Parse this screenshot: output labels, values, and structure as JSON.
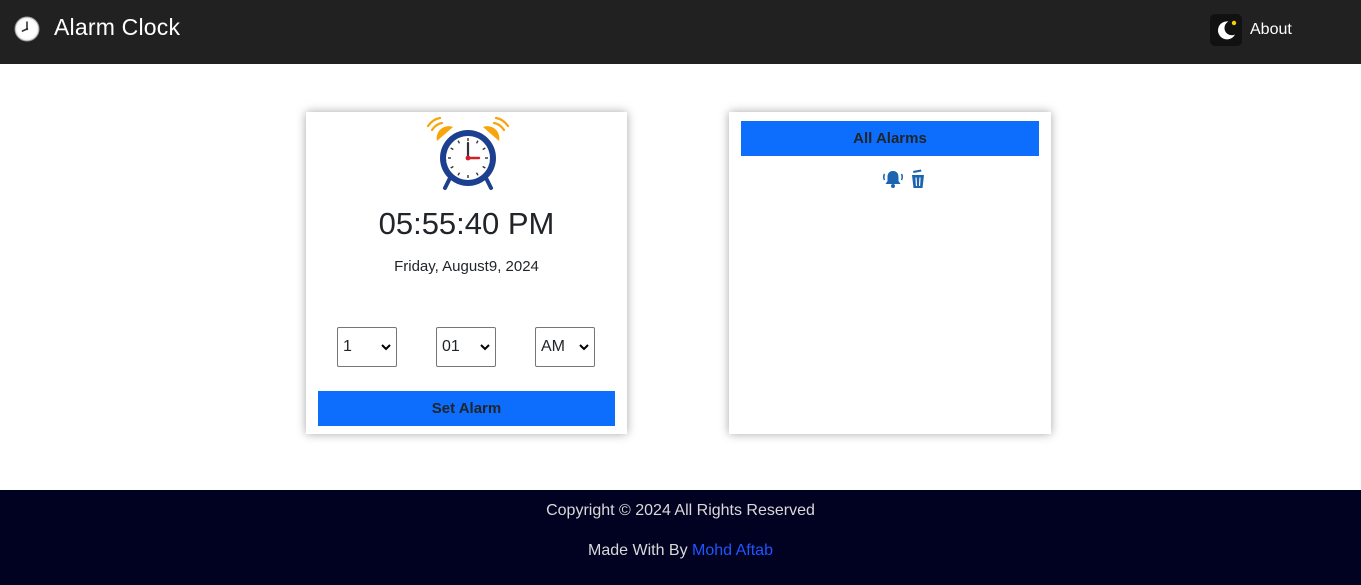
{
  "navbar": {
    "title": "Alarm Clock",
    "about_label": "About",
    "brand_icon": "clock-icon",
    "theme_icon": "moon-icon"
  },
  "clock": {
    "time": "05:55:40 PM",
    "date": "Friday, August9, 2024",
    "illustration_icon": "alarm-clock-icon"
  },
  "controls": {
    "hour": "1",
    "minute": "01",
    "ampm": "AM",
    "set_alarm_label": "Set Alarm"
  },
  "alarms": {
    "header": "All Alarms",
    "item_icons": [
      "ringing-bell-icon",
      "trash-icon"
    ]
  },
  "footer": {
    "copyright": "Copyright © 2024 All Rights Reserved",
    "made_with_prefix": "Made With By ",
    "author": "Mohd Aftab"
  },
  "colors": {
    "navbar_bg": "#212121",
    "primary": "#0d6efd",
    "footer_bg": "#010221",
    "link": "#1e56ff",
    "icon_blue": "#1a64b0"
  }
}
